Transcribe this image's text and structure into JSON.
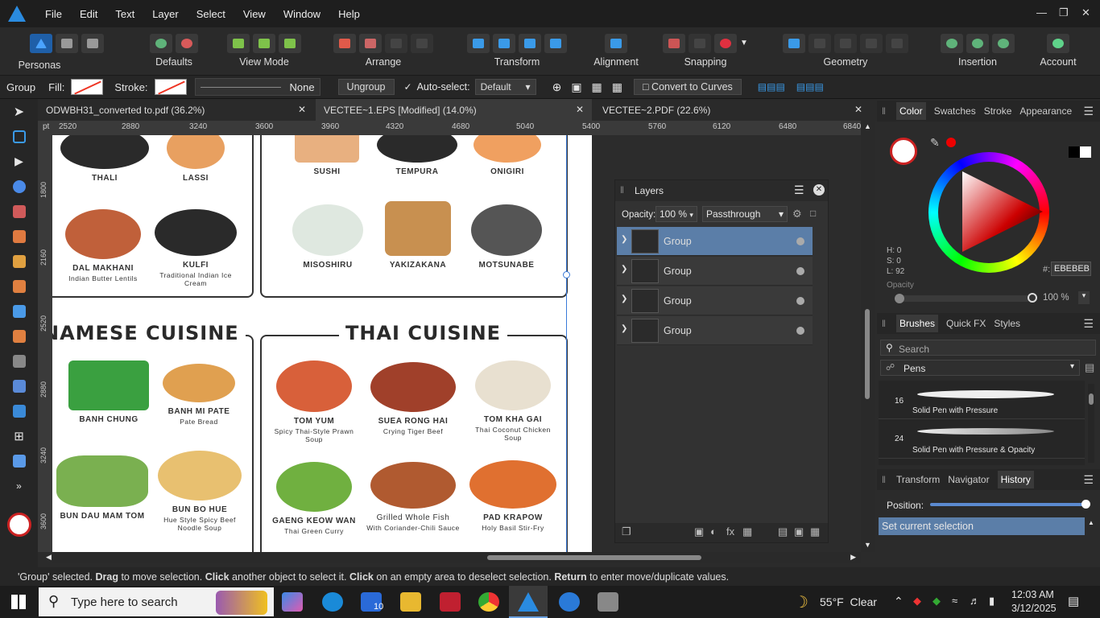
{
  "menubar": {
    "items": [
      "File",
      "Edit",
      "Text",
      "Layer",
      "Select",
      "View",
      "Window",
      "Help"
    ]
  },
  "toolbar": {
    "groups": [
      "Personas",
      "Defaults",
      "View Mode",
      "Arrange",
      "Transform",
      "Alignment",
      "Snapping",
      "Geometry",
      "Insertion",
      "Account"
    ]
  },
  "context": {
    "selection": "Group",
    "fill_label": "Fill:",
    "stroke_label": "Stroke:",
    "stroke_style": "None",
    "ungroup": "Ungroup",
    "autoselect_label": "Auto-select:",
    "autoselect_value": "Default",
    "convert": "Convert to Curves"
  },
  "tabs": [
    {
      "label": "ODWBH31_converted to.pdf (36.2%)"
    },
    {
      "label": "VECTEE~1.EPS [Modified] (14.0%)"
    },
    {
      "label": "VECTEE~2.PDF (22.6%)"
    }
  ],
  "ruler": {
    "unit": "pt",
    "top": [
      "2520",
      "2880",
      "3240",
      "3600",
      "3960",
      "4320",
      "4680",
      "5040",
      "5400",
      "5760",
      "6120",
      "6480",
      "6840"
    ],
    "left": [
      "1800",
      "2160",
      "2520",
      "2880",
      "3240",
      "3600"
    ]
  },
  "page": {
    "top_left": [
      {
        "n": "THALI",
        "s": ""
      },
      {
        "n": "LASSI",
        "s": ""
      },
      {
        "n": "DAL MAKHANI",
        "s": "Indian Butter Lentils"
      },
      {
        "n": "KULFI",
        "s": "Traditional Indian Ice Cream"
      }
    ],
    "top_right": [
      {
        "n": "SUSHI",
        "s": ""
      },
      {
        "n": "TEMPURA",
        "s": ""
      },
      {
        "n": "ONIGIRI",
        "s": ""
      },
      {
        "n": "MISOSHIRU",
        "s": ""
      },
      {
        "n": "YAKIZAKANA",
        "s": ""
      },
      {
        "n": "MOTSUNABE",
        "s": ""
      }
    ],
    "viet_title": "NAMESE CUISINE",
    "thai_title": "THAI CUISINE",
    "viet": [
      {
        "n": "BANH CHUNG",
        "s": ""
      },
      {
        "n": "BANH MI PATE",
        "s": "Pate Bread"
      },
      {
        "n": "BUN DAU MAM TOM",
        "s": ""
      },
      {
        "n": "BUN BO HUE",
        "s": "Hue Style Spicy Beef Noodle Soup"
      }
    ],
    "thai": [
      {
        "n": "TOM YUM",
        "s": "Spicy Thai-Style Prawn Soup"
      },
      {
        "n": "SUEA RONG HAI",
        "s": "Crying Tiger Beef"
      },
      {
        "n": "TOM KHA GAI",
        "s": "Thai Coconut Chicken Soup"
      },
      {
        "n": "GAENG KEOW WAN",
        "s": "Thai Green Curry"
      },
      {
        "n": "Grilled Whole Fish",
        "s": "With Coriander-Chili Sauce"
      },
      {
        "n": "PAD KRAPOW",
        "s": "Holy Basil Stir-Fry"
      }
    ]
  },
  "layers": {
    "title": "Layers",
    "opacity_label": "Opacity:",
    "opacity_value": "100 %",
    "blend": "Passthrough",
    "rows": [
      "Group",
      "Group",
      "Group",
      "Group"
    ]
  },
  "color_panel": {
    "tabs": [
      "Color",
      "Swatches",
      "Stroke",
      "Appearance"
    ],
    "h": "H: 0",
    "s": "S: 0",
    "l": "L: 92",
    "hex_label": "#:",
    "hex": "EBEBEB",
    "opacity_label": "Opacity",
    "opacity_value": "100 %"
  },
  "brushes_panel": {
    "tabs": [
      "Brushes",
      "Quick FX",
      "Styles"
    ],
    "search_placeholder": "Search",
    "category": "Pens",
    "items": [
      {
        "size": "16",
        "name": "Solid Pen with Pressure"
      },
      {
        "size": "24",
        "name": "Solid Pen with Pressure & Opacity"
      }
    ]
  },
  "history_panel": {
    "tabs": [
      "Transform",
      "Navigator",
      "History"
    ],
    "position_label": "Position:",
    "entry": "Set current selection"
  },
  "status": {
    "q1": "'Group' selected. ",
    "b1": "Drag",
    "t1": " to move selection. ",
    "b2": "Click",
    "t2": " another object to select it. ",
    "b3": "Click",
    "t3": " on an empty area to deselect selection. ",
    "b4": "Return",
    "t4": " to enter move/duplicate values."
  },
  "taskbar": {
    "search_placeholder": "Type here to search",
    "weather": "55°F  Clear",
    "time": "12:03 AM",
    "date": "3/12/2025",
    "mail_badge": "10"
  }
}
